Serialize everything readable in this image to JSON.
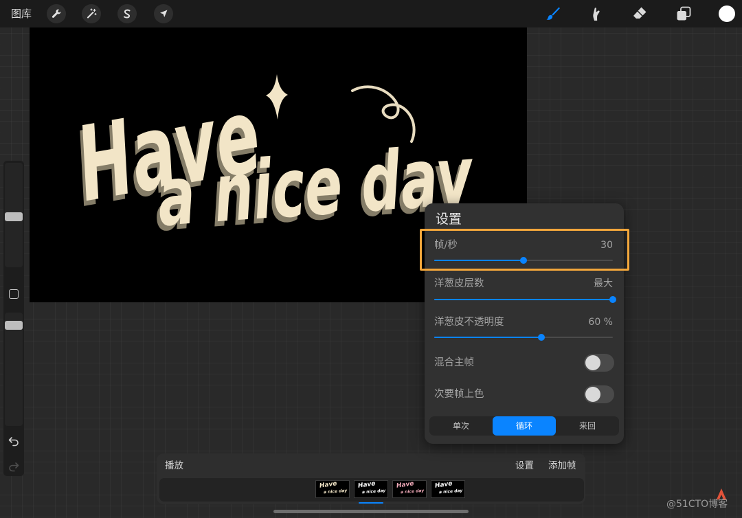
{
  "top_bar": {
    "gallery_label": "图库",
    "left_tools": [
      "wrench-icon",
      "magic-wand-icon",
      "selection-icon",
      "transform-icon"
    ],
    "right_tools": [
      "brush-icon",
      "smudge-icon",
      "eraser-icon",
      "layers-icon",
      "color-circle-icon"
    ],
    "active_tool": "brush-icon"
  },
  "sidebar": {
    "brush_size_level": 0.48,
    "opacity_level": 0.92,
    "icons": [
      "square-icon",
      "undo-icon",
      "redo-icon"
    ]
  },
  "artwork": {
    "line1": "Have",
    "line2": "a nice day"
  },
  "settings_panel": {
    "title": "设置",
    "frame_rate": {
      "label": "帧/秒",
      "value": "30",
      "fill": 0.5
    },
    "onion_skin_frames": {
      "label": "洋葱皮层数",
      "value": "最大",
      "fill": 1.0
    },
    "onion_skin_opacity": {
      "label": "洋葱皮不透明度",
      "value": "60 %",
      "fill": 0.6
    },
    "blend_primary_frame": {
      "label": "混合主帧",
      "on": false
    },
    "color_secondary_frames": {
      "label": "次要帧上色",
      "on": false
    },
    "playback_modes": {
      "options": [
        "单次",
        "循环",
        "来回"
      ],
      "selected": "循环"
    }
  },
  "timeline": {
    "play_label": "播放",
    "settings_label": "设置",
    "add_frame_label": "添加帧",
    "frames": [
      {
        "tint": "#f2e5c7"
      },
      {
        "tint": "#ffffff"
      },
      {
        "tint": "#f0a9b8"
      },
      {
        "tint": "#ffffff"
      }
    ],
    "selected_frame_index": 1
  },
  "watermark": {
    "text": "@51CTO博客",
    "logo": "51cto-logo-icon"
  },
  "colors": {
    "accent": "#0a84ff",
    "highlight": "#f3a73b",
    "artwork_fill": "#f2e5c7",
    "artwork_shadow": "#857d68",
    "current_color": "#ffffff"
  }
}
